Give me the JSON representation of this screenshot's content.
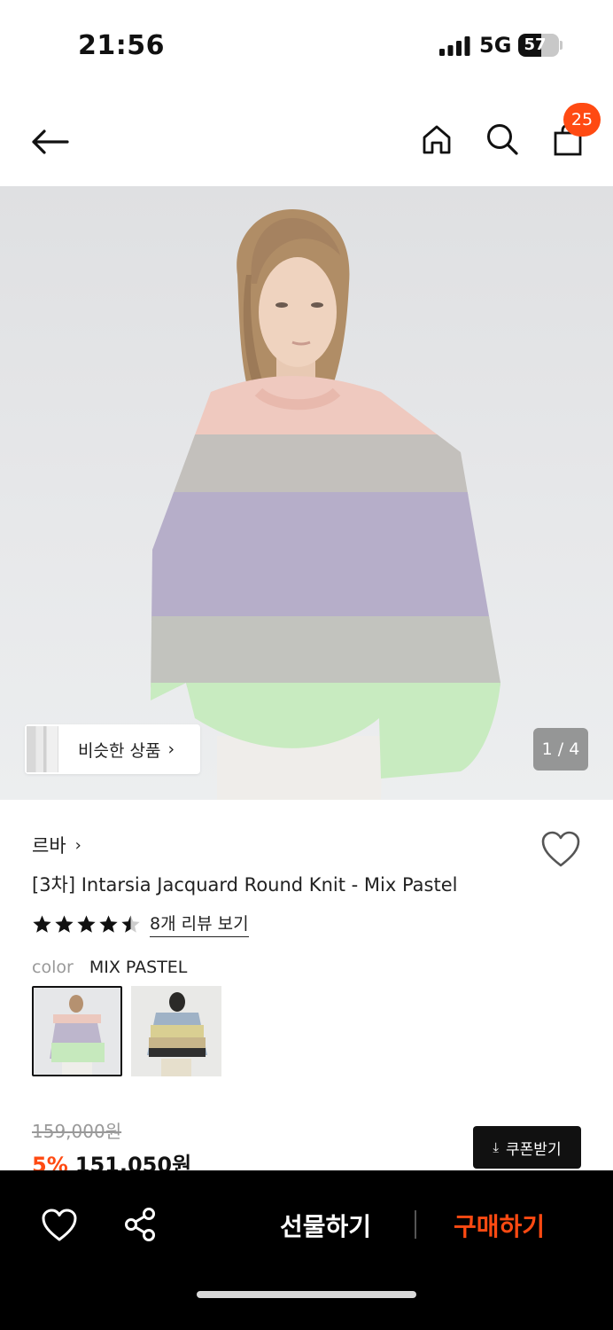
{
  "status": {
    "time": "21:56",
    "network": "5G",
    "battery": "57",
    "battery_level": 0.57
  },
  "header": {
    "cart_count": "25"
  },
  "hero": {
    "similar_label": "비슷한 상품",
    "page_counter": "1 / 4"
  },
  "product": {
    "brand": "르바",
    "title": "[3차] Intarsia Jacquard Round Knit - Mix Pastel",
    "rating": 4.5,
    "review_link": "8개 리뷰 보기",
    "color_label": "color",
    "color_value": "MIX PASTEL",
    "original_price": "159,000원",
    "discount": "5%",
    "sale_price": "151,050원",
    "coupon_label": "쿠폰받기"
  },
  "bottom_bar": {
    "gift_label": "선물하기",
    "buy_label": "구매하기"
  },
  "colors": {
    "accent": "#ff4a12",
    "dark": "#111111"
  }
}
